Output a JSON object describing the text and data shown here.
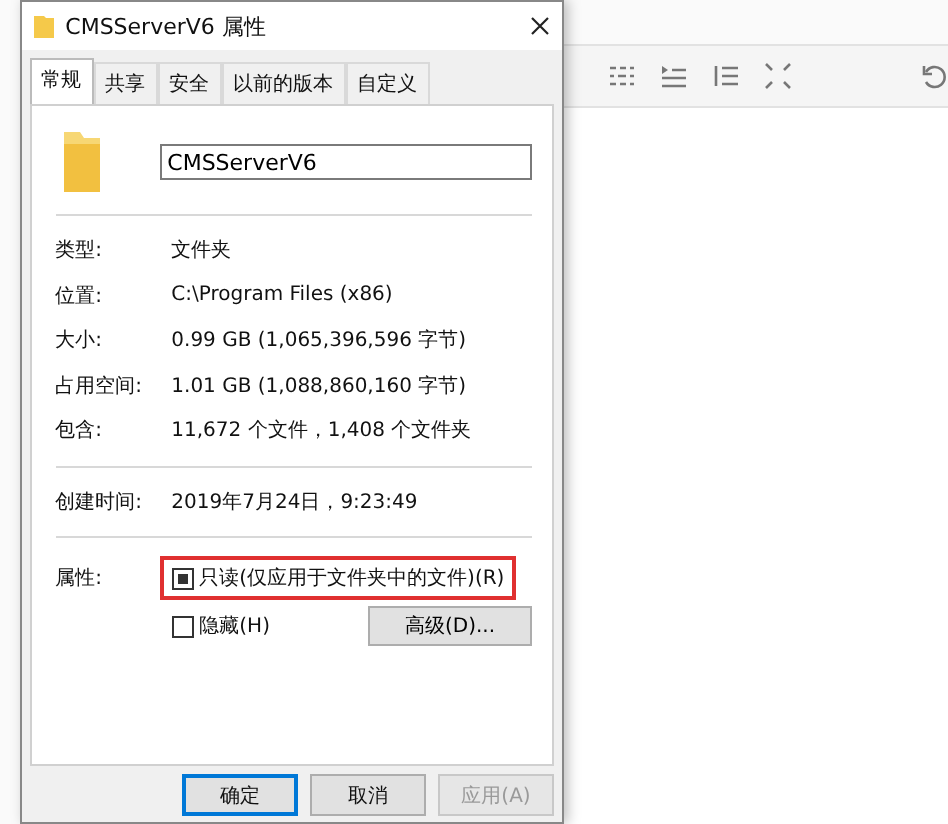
{
  "window": {
    "title": "CMSServerV6 属性"
  },
  "tabs": [
    {
      "label": "常规",
      "selected": true
    },
    {
      "label": "共享",
      "selected": false
    },
    {
      "label": "安全",
      "selected": false
    },
    {
      "label": "以前的版本",
      "selected": false
    },
    {
      "label": "自定义",
      "selected": false
    }
  ],
  "name_field": {
    "value": "CMSServerV6"
  },
  "details": [
    {
      "label": "类型:",
      "value": "文件夹"
    },
    {
      "label": "位置:",
      "value": "C:\\Program Files (x86)"
    },
    {
      "label": "大小:",
      "value": "0.99 GB (1,065,396,596 字节)"
    },
    {
      "label": "占用空间:",
      "value": "1.01 GB (1,088,860,160 字节)"
    },
    {
      "label": "包含:",
      "value": "11,672 个文件，1,408 个文件夹"
    }
  ],
  "created": {
    "label": "创建时间:",
    "value": "2019年7月24日，9:23:49"
  },
  "attributes": {
    "label": "属性:",
    "options": [
      {
        "label": "只读(仅应用于文件夹中的文件)(R)",
        "mixed": true,
        "highlighted": true
      },
      {
        "label": "隐藏(H)",
        "checked": false,
        "mixed": false,
        "highlighted": false
      }
    ],
    "advanced_button": "高级(D)..."
  },
  "buttons": [
    {
      "label": "确定",
      "kind": "default",
      "disabled": false
    },
    {
      "label": "取消",
      "kind": "normal",
      "disabled": false
    },
    {
      "label": "应用(A)",
      "kind": "normal",
      "disabled": true
    }
  ]
}
